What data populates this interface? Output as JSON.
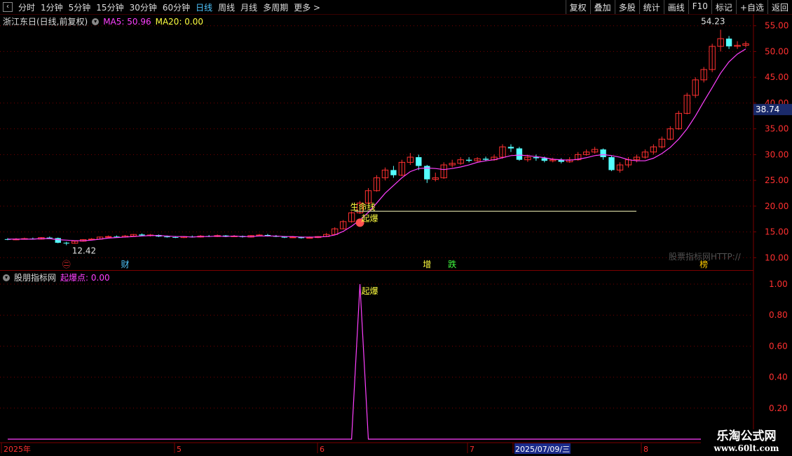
{
  "toolbar": {
    "back_icon": "back-icon",
    "periods": [
      "分时",
      "1分钟",
      "5分钟",
      "15分钟",
      "30分钟",
      "60分钟",
      "日线",
      "周线",
      "月线",
      "多周期",
      "更多 >"
    ],
    "active_period": "日线",
    "tools": [
      "复权",
      "叠加",
      "多股",
      "统计",
      "画线",
      "F10",
      "标记",
      "+自选",
      "返回"
    ]
  },
  "main_panel": {
    "title": "浙江东日(日线,前复权)",
    "ma5_label": "MA5: 50.96",
    "ma20_label": "MA20: 0.00",
    "price_ticks": [
      "55.00",
      "50.00",
      "45.00",
      "40.00",
      "35.00",
      "30.00",
      "25.00",
      "20.00",
      "15.00",
      "10.00"
    ],
    "current_price_tag": "38.74",
    "high_label": "54.23",
    "low_label": "12.42",
    "line_label": "生命线",
    "signal_label": "起爆",
    "site_text": "股票指标网HTTP://",
    "markers": [
      {
        "text": "㊁",
        "color": "#ff3030"
      },
      {
        "text": "财",
        "color": "#4fc6ff"
      },
      {
        "text": "增",
        "color": "#ffff40"
      },
      {
        "text": "跌",
        "color": "#40ff40"
      },
      {
        "text": "榜",
        "color": "#ffcc00"
      }
    ],
    "colors": {
      "up": "#ff3030",
      "down": "#54ffff",
      "ma5": "#ff40ff",
      "ma20": "#ffff40",
      "grid": "#7a0000"
    }
  },
  "sub_panel": {
    "title": "股朋指标网",
    "indicator_label": "起爆点: 0.00",
    "peak_label": "起爆",
    "ticks": [
      "1.00",
      "0.80",
      "0.60",
      "0.40",
      "0.20"
    ]
  },
  "date_axis": {
    "labels": [
      "2025年",
      "5",
      "6",
      "7",
      "2025/07/09/三",
      "8"
    ]
  },
  "watermark": {
    "line1": "乐淘公式网",
    "line2": "www.60lt.com"
  },
  "chart_data": {
    "type": "candlestick",
    "series": "浙江东日 daily",
    "ma5_current": 50.96,
    "current_price": 38.74,
    "high": 54.23,
    "low": 12.42,
    "ylim": [
      8,
      57
    ],
    "life_line_level": 19,
    "candles": [
      [
        13.6,
        13.5,
        13.8,
        13.4
      ],
      [
        13.5,
        13.6,
        13.8,
        13.4
      ],
      [
        13.6,
        13.7,
        13.9,
        13.5
      ],
      [
        13.7,
        13.6,
        13.9,
        13.5
      ],
      [
        13.6,
        13.9,
        14.0,
        13.5
      ],
      [
        13.9,
        13.8,
        14.1,
        13.7
      ],
      [
        13.8,
        12.9,
        13.9,
        12.8
      ],
      [
        12.9,
        12.8,
        13.1,
        12.42
      ],
      [
        12.8,
        13.2,
        13.3,
        12.7
      ],
      [
        13.2,
        13.5,
        13.6,
        13.1
      ],
      [
        13.5,
        13.6,
        13.8,
        13.4
      ],
      [
        13.6,
        14.0,
        14.1,
        13.5
      ],
      [
        14.0,
        14.1,
        14.3,
        13.9
      ],
      [
        14.1,
        14.0,
        14.3,
        13.9
      ],
      [
        14.0,
        14.2,
        14.4,
        13.9
      ],
      [
        14.2,
        14.5,
        14.6,
        14.1
      ],
      [
        14.5,
        14.3,
        14.7,
        14.2
      ],
      [
        14.3,
        14.4,
        14.6,
        14.1
      ],
      [
        14.4,
        14.1,
        14.5,
        14.0
      ],
      [
        14.1,
        14.0,
        14.3,
        13.9
      ],
      [
        14.0,
        13.9,
        14.2,
        13.8
      ],
      [
        13.9,
        14.1,
        14.2,
        13.8
      ],
      [
        14.1,
        14.0,
        14.3,
        13.9
      ],
      [
        14.0,
        14.2,
        14.4,
        13.9
      ],
      [
        14.2,
        14.1,
        14.4,
        14.0
      ],
      [
        14.1,
        14.3,
        14.5,
        14.0
      ],
      [
        14.3,
        14.1,
        14.4,
        14.0
      ],
      [
        14.1,
        14.2,
        14.4,
        14.0
      ],
      [
        14.2,
        14.0,
        14.3,
        13.9
      ],
      [
        14.0,
        14.3,
        14.4,
        13.9
      ],
      [
        14.3,
        14.4,
        14.6,
        14.2
      ],
      [
        14.4,
        14.2,
        14.6,
        14.1
      ],
      [
        14.2,
        14.1,
        14.4,
        14.0
      ],
      [
        14.1,
        13.9,
        14.2,
        13.8
      ],
      [
        13.9,
        14.0,
        14.2,
        13.8
      ],
      [
        14.0,
        13.8,
        14.1,
        13.7
      ],
      [
        13.8,
        13.9,
        14.1,
        13.7
      ],
      [
        13.9,
        14.1,
        14.2,
        13.8
      ],
      [
        14.1,
        14.5,
        14.8,
        14.0
      ],
      [
        14.5,
        15.6,
        15.9,
        14.4
      ],
      [
        15.6,
        17.0,
        17.3,
        15.5
      ],
      [
        17.0,
        18.7,
        19.0,
        16.8
      ],
      [
        18.7,
        20.6,
        21.0,
        18.5
      ],
      [
        20.6,
        23.0,
        23.5,
        20.4
      ],
      [
        23.0,
        25.5,
        26.0,
        22.8
      ],
      [
        25.5,
        27.0,
        27.5,
        25.0
      ],
      [
        27.0,
        26.0,
        27.8,
        25.5
      ],
      [
        26.0,
        28.5,
        29.0,
        25.8
      ],
      [
        28.5,
        29.5,
        30.3,
        28.0
      ],
      [
        29.5,
        27.8,
        30.0,
        27.0
      ],
      [
        27.8,
        25.2,
        28.0,
        24.5
      ],
      [
        25.2,
        25.5,
        26.5,
        24.8
      ],
      [
        25.5,
        28.0,
        28.5,
        25.3
      ],
      [
        28.0,
        28.3,
        29.0,
        27.5
      ],
      [
        28.3,
        29.0,
        29.5,
        28.0
      ],
      [
        29.0,
        28.8,
        29.5,
        28.5
      ],
      [
        28.8,
        29.2,
        29.5,
        28.6
      ],
      [
        29.2,
        29.0,
        29.6,
        28.7
      ],
      [
        29.0,
        29.5,
        30.0,
        28.8
      ],
      [
        29.5,
        31.5,
        32.0,
        29.2
      ],
      [
        31.5,
        31.2,
        32.0,
        30.5
      ],
      [
        31.2,
        29.0,
        31.5,
        28.8
      ],
      [
        29.0,
        29.5,
        30.0,
        28.6
      ],
      [
        29.5,
        29.3,
        30.0,
        28.8
      ],
      [
        29.3,
        28.8,
        29.6,
        28.5
      ],
      [
        28.8,
        29.0,
        29.4,
        28.5
      ],
      [
        29.0,
        28.6,
        29.3,
        28.3
      ],
      [
        28.6,
        29.0,
        29.5,
        28.4
      ],
      [
        29.0,
        30.0,
        30.5,
        28.8
      ],
      [
        30.0,
        30.5,
        31.0,
        29.8
      ],
      [
        30.5,
        31.0,
        31.5,
        30.2
      ],
      [
        31.0,
        29.5,
        31.2,
        29.0
      ],
      [
        29.5,
        27.0,
        29.8,
        26.8
      ],
      [
        27.0,
        28.0,
        28.5,
        26.5
      ],
      [
        28.0,
        29.0,
        29.5,
        27.5
      ],
      [
        29.0,
        29.5,
        30.0,
        28.5
      ],
      [
        29.5,
        30.5,
        31.0,
        29.2
      ],
      [
        30.5,
        31.5,
        32.0,
        30.0
      ],
      [
        31.5,
        33.0,
        33.5,
        31.2
      ],
      [
        33.0,
        35.0,
        35.5,
        32.8
      ],
      [
        35.0,
        38.0,
        38.5,
        34.8
      ],
      [
        38.0,
        41.5,
        42.0,
        37.8
      ],
      [
        41.5,
        44.5,
        45.0,
        41.0
      ],
      [
        44.5,
        46.5,
        47.0,
        44.0
      ],
      [
        46.5,
        51.0,
        51.5,
        46.0
      ],
      [
        51.0,
        52.5,
        54.23,
        50.0
      ],
      [
        52.5,
        51.0,
        53.0,
        50.5
      ],
      [
        51.0,
        51.2,
        52.0,
        50.5
      ],
      [
        51.2,
        51.5,
        52.0,
        50.8
      ]
    ],
    "ma5_line": [
      13.6,
      13.6,
      13.6,
      13.6,
      13.7,
      13.7,
      13.5,
      13.4,
      13.3,
      13.3,
      13.4,
      13.6,
      13.8,
      13.9,
      14.0,
      14.1,
      14.2,
      14.3,
      14.3,
      14.2,
      14.1,
      14.1,
      14.0,
      14.1,
      14.1,
      14.2,
      14.1,
      14.2,
      14.1,
      14.1,
      14.2,
      14.2,
      14.2,
      14.1,
      14.1,
      14.0,
      14.0,
      14.0,
      14.1,
      14.4,
      15.1,
      16.1,
      17.3,
      18.8,
      20.6,
      22.5,
      24.0,
      25.5,
      26.7,
      27.3,
      27.4,
      27.3,
      27.1,
      27.3,
      27.6,
      28.0,
      28.5,
      28.8,
      29.0,
      29.4,
      29.8,
      29.9,
      29.8,
      29.6,
      29.4,
      29.1,
      29.0,
      28.9,
      29.1,
      29.4,
      29.8,
      30.0,
      29.8,
      29.5,
      29.0,
      28.8,
      28.8,
      29.3,
      30.2,
      31.4,
      33.0,
      35.0,
      37.5,
      40.3,
      43.0,
      45.8,
      48.0,
      49.5,
      50.5
    ],
    "sub_series": {
      "name": "起爆点",
      "peak_index": 42,
      "peak_value": 1.0
    }
  }
}
